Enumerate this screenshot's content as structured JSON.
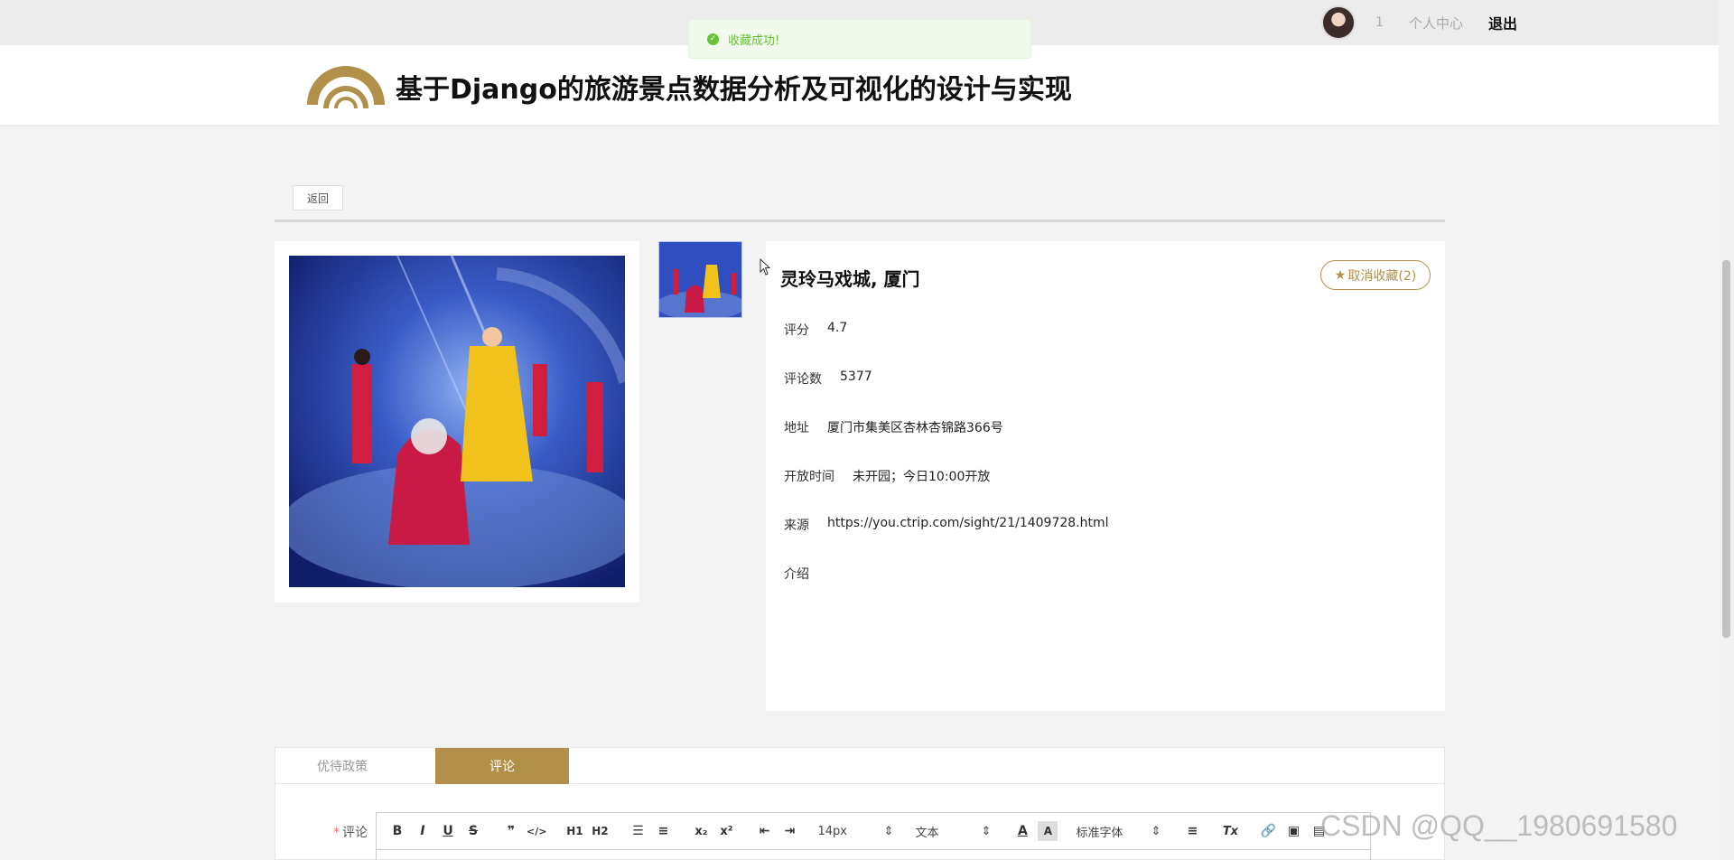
{
  "topbar": {
    "user_count": "1",
    "personal_center": "个人中心",
    "logout": "退出"
  },
  "toast": {
    "message": "收藏成功!"
  },
  "header": {
    "title": "基于Django的旅游景点数据分析及可视化的设计与实现"
  },
  "nav": {
    "back_label": "返回"
  },
  "spot": {
    "name": "灵玲马戏城, 厦门",
    "fav_label": "取消收藏(2)",
    "rating_label": "评分",
    "rating_value": "4.7",
    "reviews_label": "评论数",
    "reviews_value": "5377",
    "address_label": "地址",
    "address_value": "厦门市集美区杏林杏锦路366号",
    "hours_label": "开放时间",
    "hours_value": "未开园；今日10:00开放",
    "source_label": "来源",
    "source_value": "https://you.ctrip.com/sight/21/1409728.html",
    "intro_label": "介绍"
  },
  "tabs": {
    "policy": "优待政策",
    "comments": "评论"
  },
  "comment_form": {
    "required_mark": "*",
    "label": "评论"
  },
  "toolbar": {
    "bold": "B",
    "italic": "I",
    "underline": "U",
    "strike": "S",
    "quote": "❞",
    "code": "</>",
    "h1": "H1",
    "h2": "H2",
    "sub": "x₂",
    "sup": "x²",
    "size": "14px",
    "type": "文本",
    "font": "标准字体",
    "clean": "Tx"
  },
  "watermark": "CSDN @QQ__1980691580",
  "colors": {
    "accent": "#b2904a",
    "success": "#67c23a"
  }
}
